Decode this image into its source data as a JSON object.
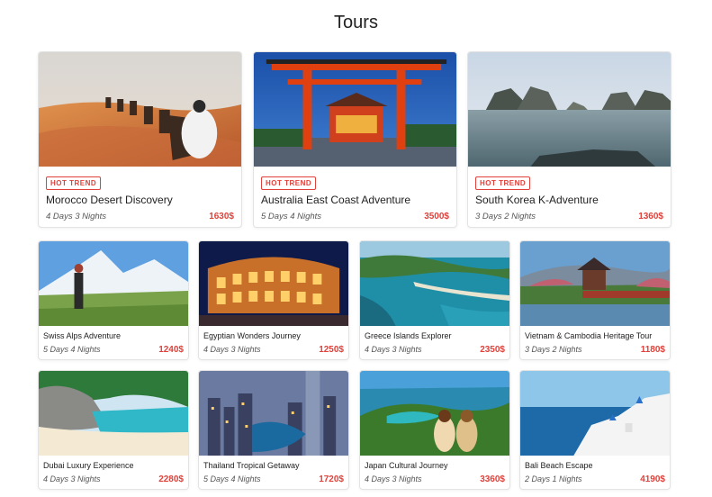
{
  "page": {
    "title": "Tours"
  },
  "featured": [
    {
      "badge": "HOT TREND",
      "title": "Morocco Desert Discovery",
      "duration": "4 Days 3 Nights",
      "price": "1630$",
      "image": "desert-camel-caravan"
    },
    {
      "badge": "HOT TREND",
      "title": "Australia East Coast Adventure",
      "duration": "5 Days 4 Nights",
      "price": "3500$",
      "image": "red-torii-gate"
    },
    {
      "badge": "HOT TREND",
      "title": "South Korea K-Adventure",
      "duration": "3 Days 2 Nights",
      "price": "1360$",
      "image": "karst-bay-boat"
    }
  ],
  "tours": [
    {
      "title": "Swiss Alps Adventure",
      "duration": "5 Days 4 Nights",
      "price": "1240$",
      "image": "alpine-hiker"
    },
    {
      "title": "Egyptian Wonders Journey",
      "duration": "4 Days 3 Nights",
      "price": "1250$",
      "image": "colosseum-night"
    },
    {
      "title": "Greece Islands Explorer",
      "duration": "4 Days 3 Nights",
      "price": "2350$",
      "image": "tropical-coast-aerial"
    },
    {
      "title": "Vietnam & Cambodia Heritage Tour",
      "duration": "3 Days 2 Nights",
      "price": "1180$",
      "image": "pagoda-garden-bridge"
    },
    {
      "title": "Dubai Luxury Experience",
      "duration": "4 Days 3 Nights",
      "price": "2280$",
      "image": "rocky-beach-turquoise"
    },
    {
      "title": "Thailand Tropical Getaway",
      "duration": "5 Days 4 Nights",
      "price": "1720$",
      "image": "city-skyline-night"
    },
    {
      "title": "Japan Cultural Journey",
      "duration": "4 Days 3 Nights",
      "price": "3360$",
      "image": "lagoon-viewpoint"
    },
    {
      "title": "Bali Beach Escape",
      "duration": "2 Days 1 Nights",
      "price": "4190$",
      "image": "white-village-sea"
    }
  ]
}
